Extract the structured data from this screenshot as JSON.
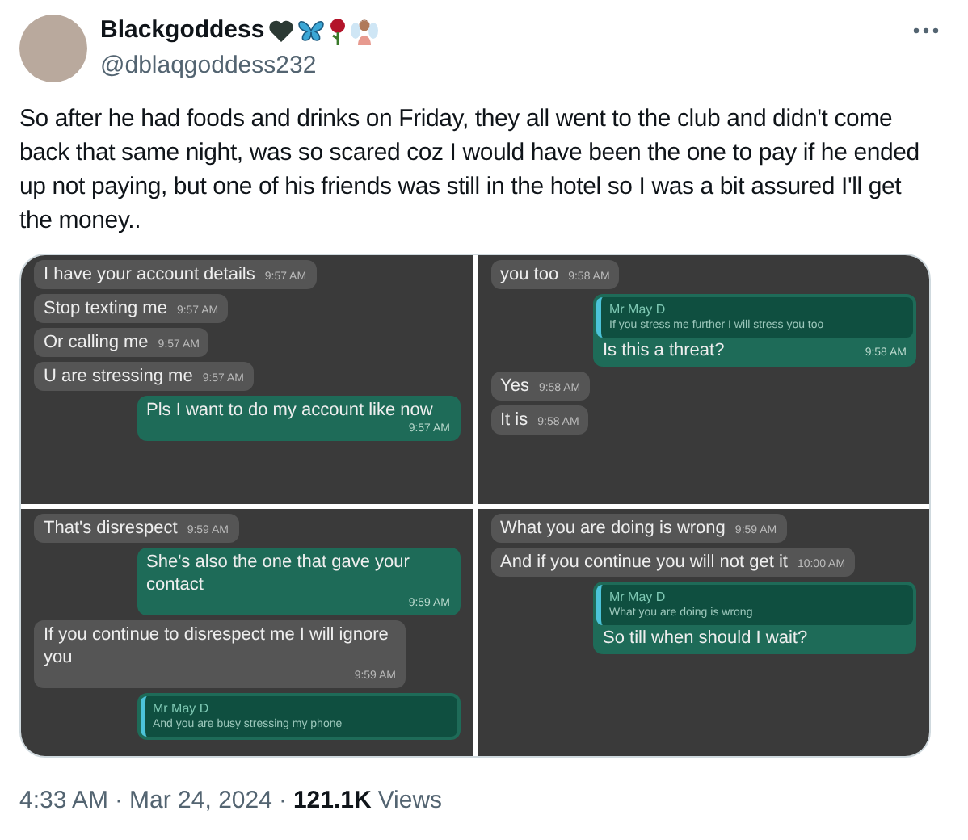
{
  "author": {
    "name": "Blackgoddess",
    "handle": "@dblaqgoddess232"
  },
  "text": "So after he had foods and drinks on Friday, they all went to the club and didn't come back that same night, was so scared coz I would have been the one to pay if he ended up not paying, but one of his friends was still in the hotel so I was a bit assured I'll get the money..",
  "panels": [
    {
      "messages": [
        {
          "kind": "in",
          "text": "I have your account details",
          "time": "9:57 AM"
        },
        {
          "kind": "in",
          "text": "Stop texting me",
          "time": "9:57 AM"
        },
        {
          "kind": "in",
          "text": "Or calling me",
          "time": "9:57 AM"
        },
        {
          "kind": "in",
          "text": "U are stressing me",
          "time": "9:57 AM"
        },
        {
          "kind": "out",
          "text": "Pls I want to do my account like now",
          "time": "9:57 AM"
        }
      ]
    },
    {
      "messages": [
        {
          "kind": "in",
          "text": "you too",
          "time": "9:58 AM"
        },
        {
          "kind": "reply",
          "quote_author": "Mr May D",
          "quote_text": "If you stress me further I will stress you too",
          "text": "Is this a threat?",
          "time": "9:58 AM"
        },
        {
          "kind": "in",
          "text": "Yes",
          "time": "9:58 AM"
        },
        {
          "kind": "in",
          "text": "It is",
          "time": "9:58 AM"
        }
      ]
    },
    {
      "messages": [
        {
          "kind": "in",
          "text": "That's disrespect",
          "time": "9:59 AM"
        },
        {
          "kind": "out",
          "text": "She's also the one that gave your contact",
          "time": "9:59 AM"
        },
        {
          "kind": "in",
          "text": "If you continue to disrespect me I will ignore you",
          "time": "9:59 AM"
        },
        {
          "kind": "reply",
          "quote_author": "Mr May D",
          "quote_text": "And you are busy stressing my phone"
        }
      ]
    },
    {
      "messages": [
        {
          "kind": "in",
          "text": "What you are doing is wrong",
          "time": "9:59 AM"
        },
        {
          "kind": "in",
          "text": "And if you continue you will not get it",
          "time": "10:00 AM"
        },
        {
          "kind": "reply",
          "quote_author": "Mr May D",
          "quote_text": "What you are doing is wrong",
          "text": "So till when should I wait?"
        }
      ]
    }
  ],
  "footer": {
    "time": "4:33 AM",
    "separator": "·",
    "date": "Mar 24, 2024",
    "views_count": "121.1K",
    "views_label": "Views"
  }
}
